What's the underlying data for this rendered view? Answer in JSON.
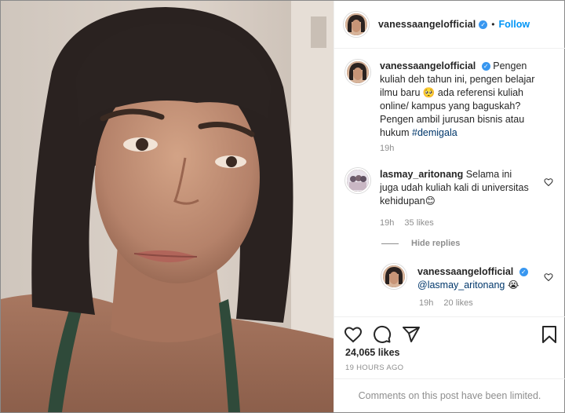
{
  "post_author": {
    "username": "vanessaangelofficial",
    "verified_label": "✓",
    "separator": "•",
    "follow_label": "Follow"
  },
  "caption": {
    "username": "vanessaangelofficial",
    "text": "Pengen kuliah deh tahun ini, pengen belajar ilmu baru 🥺 ada referensi kuliah online/ kampus yang baguskah? Pengen ambil jurusan bisnis atau hukum",
    "hashtag": "#demigala",
    "time": "19h"
  },
  "comment": {
    "username": "lasmay_aritonang",
    "text": "Selama ini juga udah kuliah kali di universitas kehidupan😊",
    "time": "19h",
    "likes": "35 likes"
  },
  "replies_toggle": "Hide replies",
  "reply": {
    "username": "vanessaangelofficial",
    "mention": "@lasmay_aritonang",
    "emoji": "😭",
    "time": "19h",
    "likes": "20 likes"
  },
  "post_stats": {
    "likes": "24,065 likes",
    "posted": "19 HOURS AGO"
  },
  "footer_notice": "Comments on this post have been limited.",
  "icons": {
    "like": "heart-icon",
    "comment": "comment-icon",
    "share": "share-icon",
    "save": "bookmark-icon"
  },
  "colors": {
    "link": "#0095f6",
    "tag": "#00376b",
    "verified": "#3897f0",
    "muted": "#8e8e8e"
  }
}
